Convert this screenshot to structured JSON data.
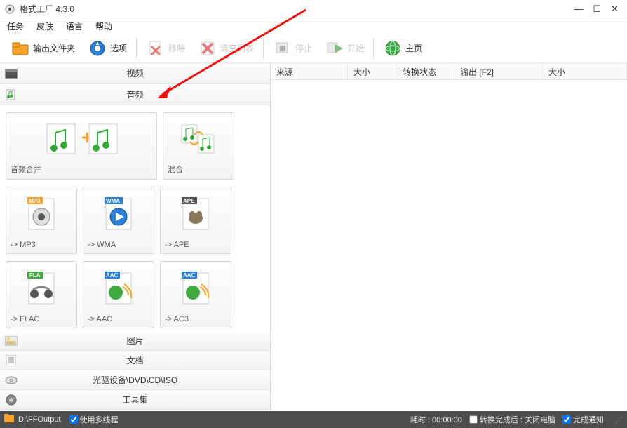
{
  "title": "格式工厂 4.3.0",
  "menu": {
    "task": "任务",
    "skin": "皮肤",
    "lang": "语言",
    "help": "帮助"
  },
  "toolbar": {
    "output": "输出文件夹",
    "options": "选项",
    "remove": "移除",
    "clear": "清空列表",
    "stop": "停止",
    "start": "开始",
    "home": "主页"
  },
  "categories": {
    "video": "视频",
    "audio": "音频",
    "image": "图片",
    "doc": "文档",
    "disc": "光驱设备\\DVD\\CD\\ISO",
    "tools": "工具集"
  },
  "audio_tiles": {
    "join": "音频合并",
    "mix": "混合",
    "mp3": "-> MP3",
    "wma": "-> WMA",
    "ape": "-> APE",
    "flac": "-> FLAC",
    "aac": "-> AAC",
    "ac3": "-> AC3"
  },
  "badges": {
    "mp3": "MP3",
    "wma": "WMA",
    "ape": "APE",
    "fla": "FLA",
    "aac": "AAC"
  },
  "table": {
    "source": "来源",
    "size": "大小",
    "status": "转换状态",
    "output": "输出 [F2]",
    "size2": "大小"
  },
  "status": {
    "path": "D:\\FFOutput",
    "multithread": "使用多线程",
    "elapsed": "耗时 : 00:00:00",
    "after_label": "转换完成后 : ",
    "after_action": "关闭电脑",
    "notify": "完成通知"
  }
}
